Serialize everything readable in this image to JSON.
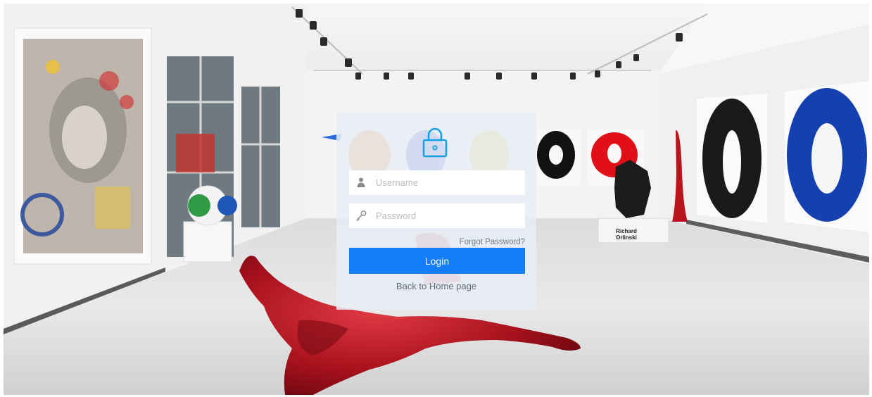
{
  "background": {
    "scene": "gallery-photo",
    "wall_sign": "Richard\nOrlinski",
    "wall_sign_line1": "Richard",
    "wall_sign_line2": "Orlinski"
  },
  "login": {
    "icon": "lock-icon",
    "username_placeholder": "Username",
    "username_icon": "user-icon",
    "password_placeholder": "Password",
    "password_icon": "key-icon",
    "forgot_label": "Forgot Password?",
    "login_label": "Login",
    "back_label": "Back to Home page",
    "accent_color": "#137ef6"
  }
}
